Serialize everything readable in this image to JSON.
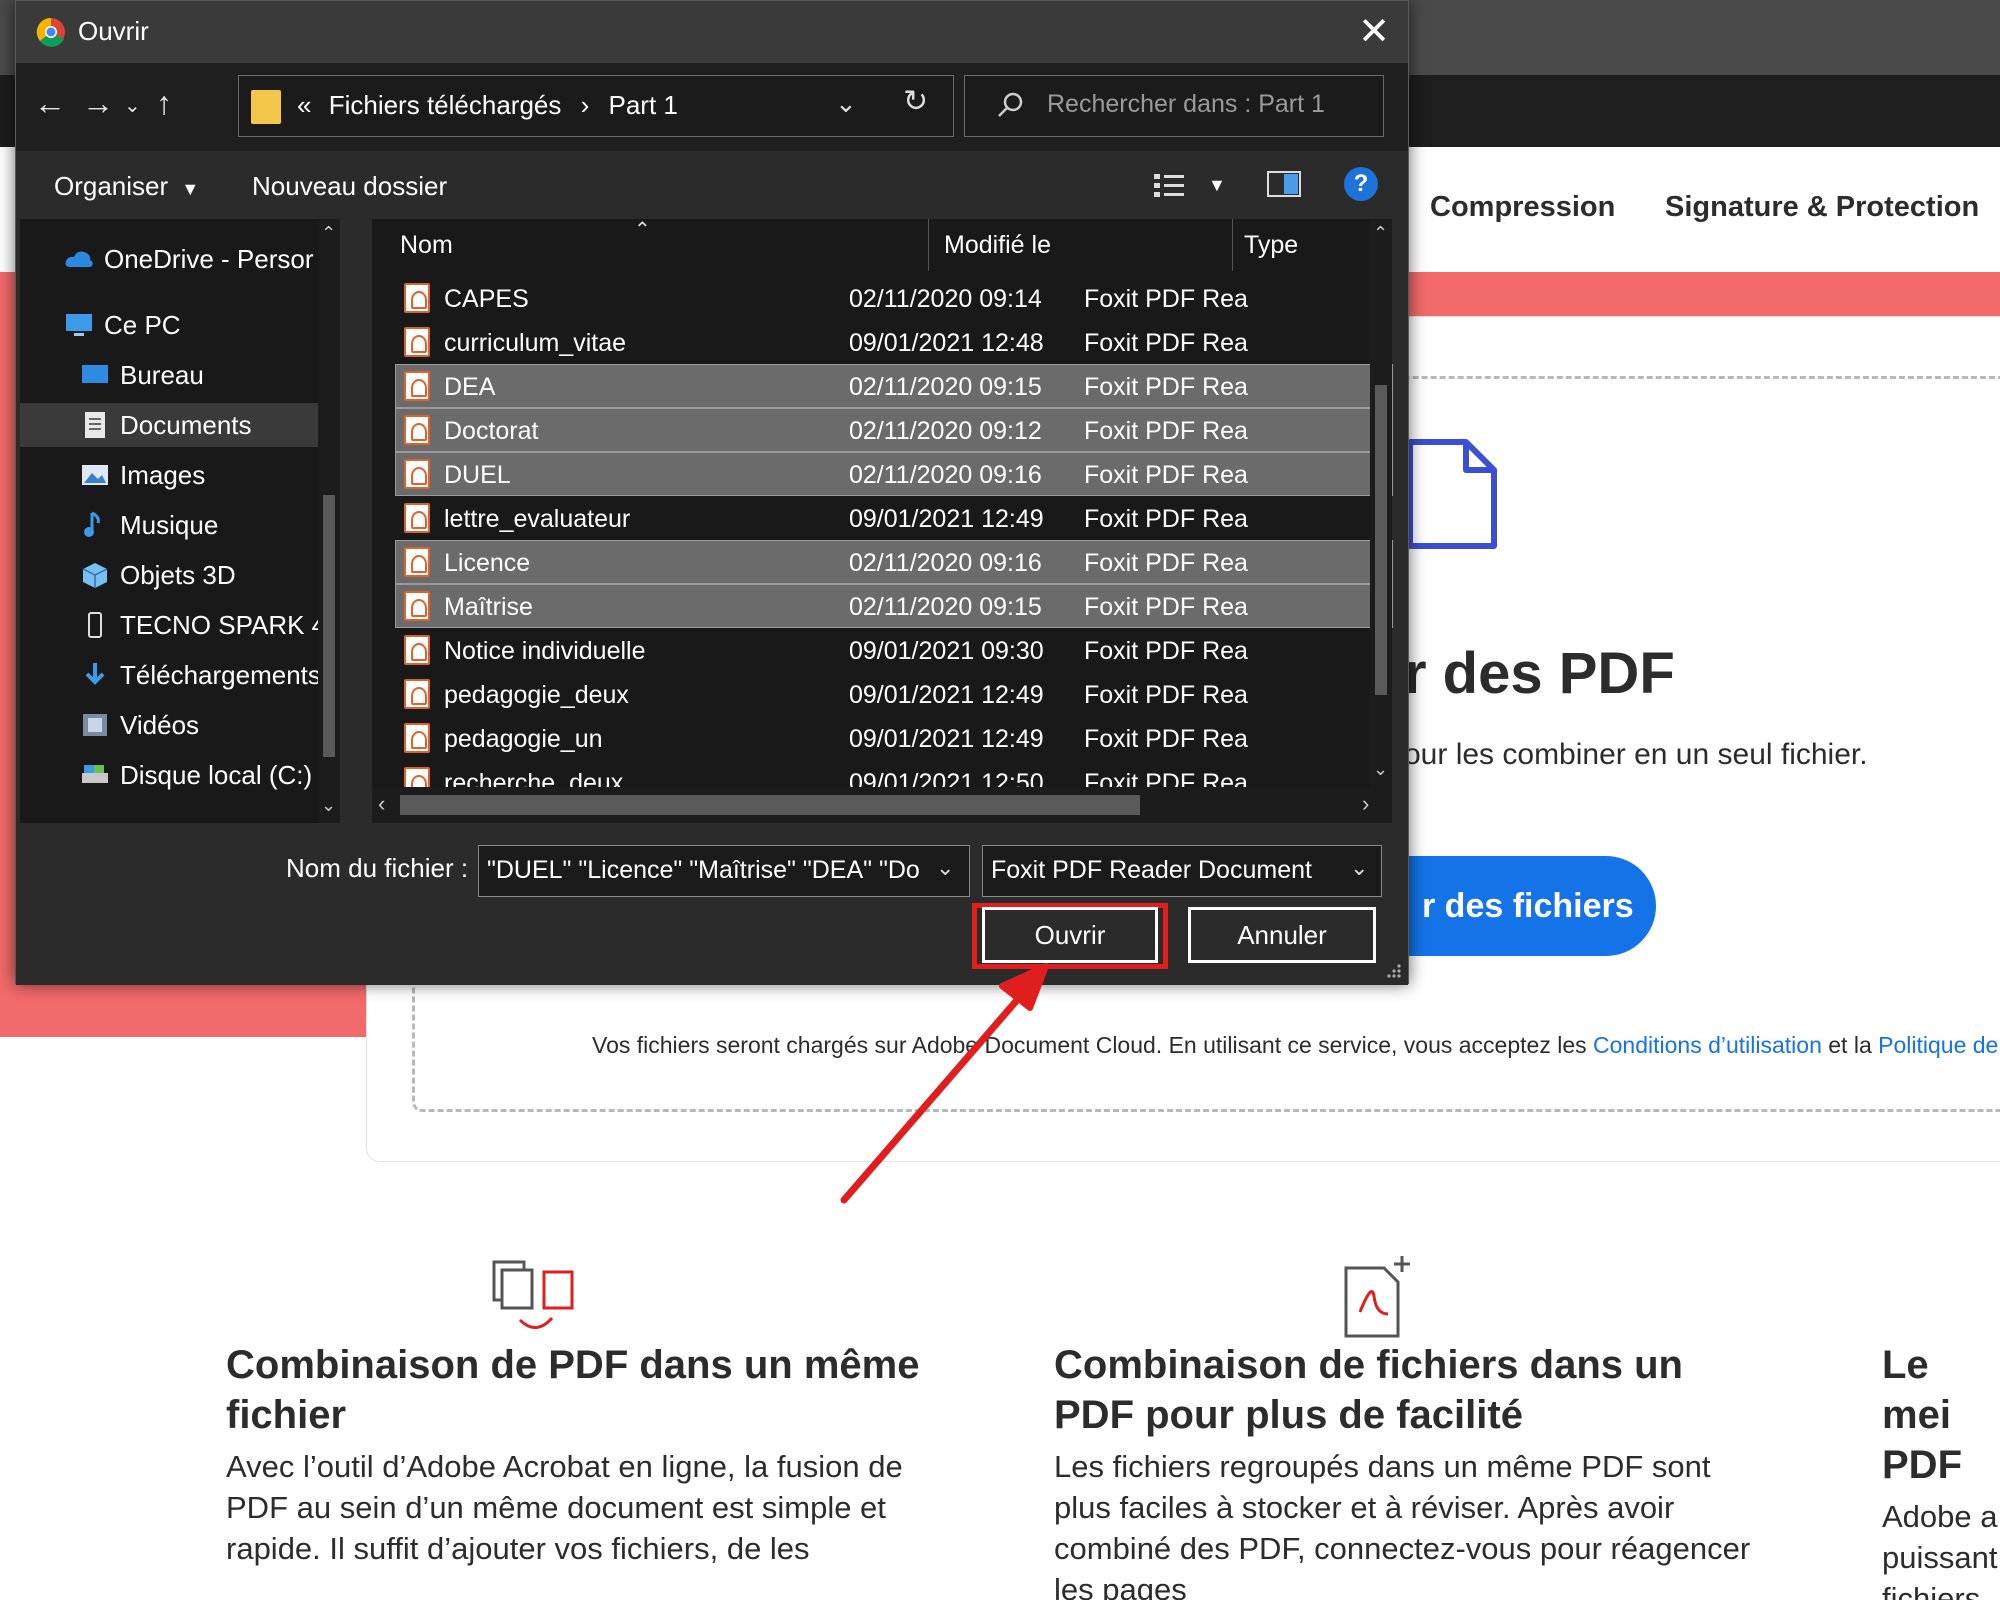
{
  "background_page": {
    "tabs": [
      "Compression",
      "Signature & Protection"
    ],
    "heading": "r des PDF",
    "subheading": "our les combiner en un seul fichier.",
    "select_button": "r des fichiers",
    "terms_text": "Vos fichiers seront chargés sur Adobe Document Cloud.  En utilisant ce service, vous acceptez les",
    "terms_link1": "Conditions d’utilisation",
    "terms_and": "et la",
    "terms_link2": "Politique de co",
    "features": [
      {
        "title": "Combinaison de PDF dans un même fichier",
        "text": "Avec l’outil d’Adobe Acrobat en ligne, la fusion de PDF au sein d’un même document est simple et rapide. Il suffit d’ajouter vos fichiers, de les"
      },
      {
        "title": "Combinaison de fichiers dans un PDF pour plus de facilité",
        "text": "Les fichiers regroupés dans un même PDF sont plus faciles à stocker et à réviser. Après avoir combiné des PDF, connectez-vous pour réagencer les pages"
      },
      {
        "title": "Le mei PDF",
        "text": "Adobe a puissant fichiers e"
      }
    ]
  },
  "dialog": {
    "title": "Ouvrir",
    "address": {
      "prefix": "«",
      "crumb1": "Fichiers téléchargés",
      "separator": "›",
      "crumb2": "Part 1"
    },
    "search_placeholder": "Rechercher dans : Part 1",
    "toolbar": {
      "organize": "Organiser",
      "new_folder": "Nouveau dossier"
    },
    "nav_items": [
      {
        "label": "OneDrive - Persor",
        "icon": "cloud-icon",
        "selected": false
      },
      {
        "label": "Ce PC",
        "icon": "computer-icon",
        "selected": false
      },
      {
        "label": "Bureau",
        "icon": "desktop-icon",
        "selected": false
      },
      {
        "label": "Documents",
        "icon": "documents-icon",
        "selected": true
      },
      {
        "label": "Images",
        "icon": "images-icon",
        "selected": false
      },
      {
        "label": "Musique",
        "icon": "music-icon",
        "selected": false
      },
      {
        "label": "Objets 3D",
        "icon": "cube-icon",
        "selected": false
      },
      {
        "label": "TECNO SPARK 4",
        "icon": "phone-icon",
        "selected": false
      },
      {
        "label": "Téléchargements",
        "icon": "download-icon",
        "selected": false
      },
      {
        "label": "Vidéos",
        "icon": "video-icon",
        "selected": false
      },
      {
        "label": "Disque local (C:)",
        "icon": "drive-icon",
        "selected": false
      }
    ],
    "columns": {
      "name": "Nom",
      "modified": "Modifié le",
      "type": "Type"
    },
    "files": [
      {
        "name": "CAPES",
        "modified": "02/11/2020 09:14",
        "type": "Foxit PDF Rea",
        "selected": false
      },
      {
        "name": "curriculum_vitae",
        "modified": "09/01/2021 12:48",
        "type": "Foxit PDF Rea",
        "selected": false
      },
      {
        "name": "DEA",
        "modified": "02/11/2020 09:15",
        "type": "Foxit PDF Rea",
        "selected": true
      },
      {
        "name": "Doctorat",
        "modified": "02/11/2020 09:12",
        "type": "Foxit PDF Rea",
        "selected": true
      },
      {
        "name": "DUEL",
        "modified": "02/11/2020 09:16",
        "type": "Foxit PDF Rea",
        "selected": true
      },
      {
        "name": "lettre_evaluateur",
        "modified": "09/01/2021 12:49",
        "type": "Foxit PDF Rea",
        "selected": false
      },
      {
        "name": "Licence",
        "modified": "02/11/2020 09:16",
        "type": "Foxit PDF Rea",
        "selected": true
      },
      {
        "name": "Maîtrise",
        "modified": "02/11/2020 09:15",
        "type": "Foxit PDF Rea",
        "selected": true
      },
      {
        "name": "Notice individuelle",
        "modified": "09/01/2021 09:30",
        "type": "Foxit PDF Rea",
        "selected": false
      },
      {
        "name": "pedagogie_deux",
        "modified": "09/01/2021 12:49",
        "type": "Foxit PDF Rea",
        "selected": false
      },
      {
        "name": "pedagogie_un",
        "modified": "09/01/2021 12:49",
        "type": "Foxit PDF Rea",
        "selected": false
      },
      {
        "name": "recherche_deux",
        "modified": "09/01/2021 12:50",
        "type": "Foxit PDF Rea",
        "selected": false
      }
    ],
    "filename_label": "Nom du fichier :",
    "filename_value": "\"DUEL\" \"Licence\" \"Maîtrise\" \"DEA\" \"Do",
    "filetype_value": "Foxit PDF Reader Document",
    "open_button": "Ouvrir",
    "cancel_button": "Annuler"
  },
  "colors": {
    "highlight_box": "#e01e1e",
    "annotation_arrow": "#e01e1e",
    "adobe_red": "#f26a6a",
    "adobe_blue": "#1473e6"
  }
}
